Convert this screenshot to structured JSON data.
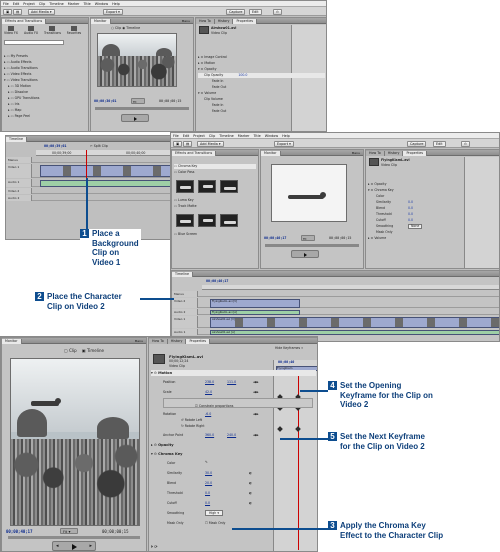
{
  "menu": {
    "items": [
      "File",
      "Edit",
      "Project",
      "Clip",
      "Timeline",
      "Marker",
      "Title",
      "Window",
      "Help"
    ]
  },
  "toolbar": {
    "add_media": "Add Media",
    "export": "Export"
  },
  "tabs": {
    "capture": "Capture",
    "edit": "Edit",
    "how_to": "How To",
    "history": "History",
    "properties": "Properties",
    "monitor": "Monitor",
    "effects": "Effects and Transitions",
    "timeline": "Timeline",
    "menu": "Menu"
  },
  "effects_panel": {
    "tab_labels": [
      "Video FX",
      "Audio FX",
      "Transitions",
      "Favorites"
    ],
    "folders": [
      "My Presets",
      "Audio Effects",
      "Audio Transitions",
      "Video Effects",
      "Video Transitions",
      "3D Motion",
      "Dissolve",
      "GPU Transitions",
      "Iris",
      "Map",
      "Page Peel"
    ]
  },
  "monitor": {
    "clip": "Clip",
    "timeline": "Timeline",
    "fit": "Fit"
  },
  "properties_1": {
    "clip_name": "Airshow01.avi",
    "clip_sub": "Video Clip",
    "rows": [
      "Image Control",
      "Motion",
      "Opacity",
      "Clip Opacity",
      "Fade In",
      "Fade Out",
      "Volume",
      "Clip Volume",
      "Fade In",
      "Fade Out"
    ],
    "opacity_value": "100.0"
  },
  "properties_3": {
    "clip_name": "FlyingKiamL.avi",
    "clip_sub": "Video Clip",
    "rows": [
      "Opacity",
      "Chroma Key",
      "Color",
      "Similarity",
      "Blend",
      "Threshold",
      "Cutoff",
      "Smoothing",
      "Mask Only",
      "Volume"
    ],
    "values": [
      "0.0",
      "0.0",
      "0.0",
      "0.0",
      "None"
    ]
  },
  "screen1": {
    "timecode_current": "00;00;30;01",
    "timecode_total": "00;00;00;15"
  },
  "screen2": {
    "timecode_current": "00;00;39;01",
    "split_clip": "Split Clip",
    "ruler": [
      "00;00;39;00",
      "00;00;40;00"
    ],
    "tracks": [
      "Menus",
      "Video 1",
      "Audio 1",
      "Video 2",
      "Audio 2"
    ]
  },
  "screen3": {
    "timecode_current": "00;00;40;17",
    "timecode_total": "00;00;00;15",
    "effects_rows": [
      "Chroma Key",
      "Color Pass",
      "Luma Key",
      "Track Matte",
      "Blue Screen"
    ],
    "timeline_tc": "00;00;40;17",
    "clip_labels": [
      "FlyingKiamL.avi [V]",
      "FlyingKiamL.avi [A]",
      "Airshow01.avi [V]",
      "Airshow01.avi [A]"
    ]
  },
  "screen4": {
    "monitor_tab": "Monitor",
    "timecode_current": "00;00;40;17",
    "timecode_total": "00;00;00;15",
    "clip_name": "FlyingKiamL.avi",
    "clip_line1": "00;00;12;24",
    "clip_line2": "Video Clip",
    "hide_keyframes": "Hide Keyframes",
    "timeline_label": "FlyingKiam",
    "kf_time": "00;00;40",
    "motion": "Motion",
    "position_label": "Position",
    "position_x": "238.0",
    "position_y": "111.0",
    "scale_label": "Scale",
    "scale_value": "42.0",
    "constrain": "Constrain proportions",
    "rotation_label": "Rotation",
    "rotation_value": "-6.0",
    "rotate_left": "Rotate Left",
    "rotate_right": "Rotate Right",
    "anchor_label": "Anchor Point",
    "anchor_x": "360.0",
    "anchor_y": "240.0",
    "opacity": "Opacity",
    "chroma_key": "Chroma Key",
    "color_label": "Color",
    "similarity_label": "Similarity",
    "similarity_value": "30.0",
    "blend_label": "Blend",
    "blend_value": "20.0",
    "threshold_label": "Threshold",
    "threshold_value": "0.0",
    "cutoff_label": "Cutoff",
    "cutoff_value": "0.0",
    "smoothing_label": "Smoothing",
    "smoothing_value": "High",
    "mask_only_label": "Mask Only",
    "mask_only_check": "Mask Only"
  },
  "callouts": {
    "c1": {
      "num": "1",
      "lines": [
        "Place a",
        "Background",
        "Clip on",
        "Video 1"
      ]
    },
    "c2": {
      "num": "2",
      "lines": [
        "Place the Character",
        "Clip on Video 2"
      ]
    },
    "c4": {
      "num": "4",
      "lines": [
        "Set the Opening",
        "Keyframe for the Clip on",
        "Video 2"
      ]
    },
    "c5": {
      "num": "5",
      "lines": [
        "Set the Next Keyframe",
        "for the Clip on Video 2"
      ]
    },
    "c3": {
      "num": "3",
      "lines": [
        "Apply the Chroma Key",
        "Effect to the Character Clip"
      ]
    }
  },
  "colors": {
    "callout_blue": "#0d4d8f",
    "callout_text": "#0d3f7a",
    "timecode_blue": "#0b2a8e"
  }
}
